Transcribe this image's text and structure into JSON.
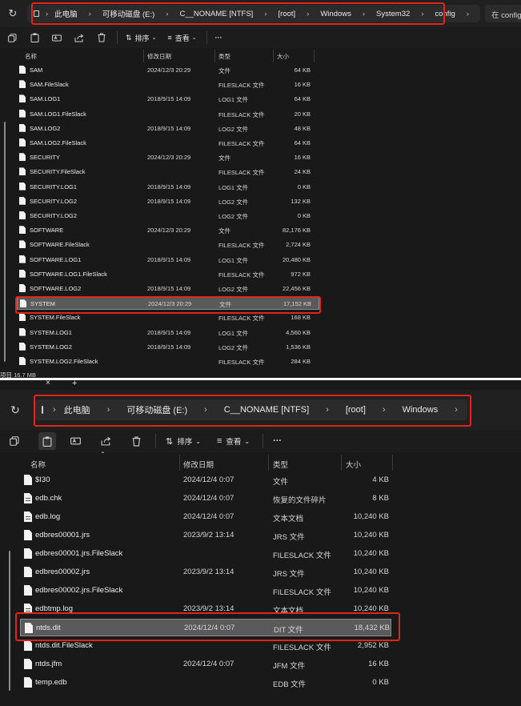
{
  "top": {
    "breadcrumb": [
      "此电脑",
      "可移动磁盘 (E:)",
      "C__NONAME [NTFS]",
      "[root]",
      "Windows",
      "System32",
      "config"
    ],
    "search_placeholder": "在 config",
    "toolbar": {
      "sort_label": "排序",
      "view_label": "查看",
      "more_label": "···"
    },
    "columns": {
      "name": "名称",
      "date": "修改日期",
      "type": "类型",
      "size": "大小"
    },
    "files": [
      {
        "name": "SAM",
        "date": "2024/12/3 20:29",
        "type": "文件",
        "size": "64 KB"
      },
      {
        "name": "SAM.FileSlack",
        "date": "",
        "type": "FILESLACK 文件",
        "size": "16 KB"
      },
      {
        "name": "SAM.LOG1",
        "date": "2018/9/15 14:09",
        "type": "LOG1 文件",
        "size": "64 KB"
      },
      {
        "name": "SAM.LOG1.FileSlack",
        "date": "",
        "type": "FILESLACK 文件",
        "size": "20 KB"
      },
      {
        "name": "SAM.LOG2",
        "date": "2018/9/15 14:09",
        "type": "LOG2 文件",
        "size": "48 KB"
      },
      {
        "name": "SAM.LOG2.FileSlack",
        "date": "",
        "type": "FILESLACK 文件",
        "size": "64 KB"
      },
      {
        "name": "SECURITY",
        "date": "2024/12/3 20:29",
        "type": "文件",
        "size": "16 KB"
      },
      {
        "name": "SECURITY.FileSlack",
        "date": "",
        "type": "FILESLACK 文件",
        "size": "24 KB"
      },
      {
        "name": "SECURITY.LOG1",
        "date": "2018/9/15 14:09",
        "type": "LOG1 文件",
        "size": "0 KB"
      },
      {
        "name": "SECURITY.LOG2",
        "date": "2018/9/15 14:09",
        "type": "LOG2 文件",
        "size": "132 KB"
      },
      {
        "name": "SECURITY.LOG2",
        "date": "",
        "type": "LOG2 文件",
        "size": "0 KB"
      },
      {
        "name": "SOFTWARE",
        "date": "2024/12/3 20:29",
        "type": "文件",
        "size": "82,176 KB"
      },
      {
        "name": "SOFTWARE.FileSlack",
        "date": "",
        "type": "FILESLACK 文件",
        "size": "2,724 KB"
      },
      {
        "name": "SOFTWARE.LOG1",
        "date": "2018/9/15 14:09",
        "type": "LOG1 文件",
        "size": "20,480 KB"
      },
      {
        "name": "SOFTWARE.LOG1.FileSlack",
        "date": "",
        "type": "FILESLACK 文件",
        "size": "972 KB"
      },
      {
        "name": "SOFTWARE.LOG2",
        "date": "2018/9/15 14:09",
        "type": "LOG2 文件",
        "size": "22,456 KB"
      },
      {
        "name": "SYSTEM",
        "date": "2024/12/3 20:29",
        "type": "文件",
        "size": "17,152 KB",
        "selected": true
      },
      {
        "name": "SYSTEM.FileSlack",
        "date": "",
        "type": "FILESLACK 文件",
        "size": "168 KB"
      },
      {
        "name": "SYSTEM.LOG1",
        "date": "2018/9/15 14:09",
        "type": "LOG1 文件",
        "size": "4,560 KB"
      },
      {
        "name": "SYSTEM.LOG2",
        "date": "2018/9/15 14:09",
        "type": "LOG2 文件",
        "size": "1,536 KB"
      },
      {
        "name": "SYSTEM.LOG2.FileSlack",
        "date": "",
        "type": "FILESLACK 文件",
        "size": "284 KB"
      }
    ],
    "status": "项目  16.7 MB"
  },
  "bottom": {
    "tab_close": "×",
    "tab_new": "+",
    "breadcrumb": [
      "此电脑",
      "可移动磁盘 (E:)",
      "C__NONAME [NTFS]",
      "[root]",
      "Windows",
      "NTDS"
    ],
    "toolbar": {
      "sort_label": "排序",
      "view_label": "查看",
      "more_label": "···"
    },
    "columns": {
      "name": "名称",
      "date": "修改日期",
      "type": "类型",
      "size": "大小"
    },
    "files": [
      {
        "name": "$I30",
        "date": "2024/12/4 0:07",
        "type": "文件",
        "size": "4 KB",
        "icon": "file"
      },
      {
        "name": "edb.chk",
        "date": "2024/12/4 0:07",
        "type": "恢复的文件碎片",
        "size": "8 KB",
        "icon": "doc"
      },
      {
        "name": "edb.log",
        "date": "2024/12/4 0:07",
        "type": "文本文档",
        "size": "10,240 KB",
        "icon": "doc"
      },
      {
        "name": "edbres00001.jrs",
        "date": "2023/9/2 13:14",
        "type": "JRS 文件",
        "size": "10,240 KB",
        "icon": "file"
      },
      {
        "name": "edbres00001.jrs.FileSlack",
        "date": "",
        "type": "FILESLACK 文件",
        "size": "10,240 KB",
        "icon": "file"
      },
      {
        "name": "edbres00002.jrs",
        "date": "2023/9/2 13:14",
        "type": "JRS 文件",
        "size": "10,240 KB",
        "icon": "file"
      },
      {
        "name": "edbres00002.jrs.FileSlack",
        "date": "",
        "type": "FILESLACK 文件",
        "size": "10,240 KB",
        "icon": "file"
      },
      {
        "name": "edbtmp.log",
        "date": "2023/9/2 13:14",
        "type": "文本文档",
        "size": "10,240 KB",
        "icon": "doc"
      },
      {
        "name": "ntds.dit",
        "date": "2024/12/4 0:07",
        "type": "DIT 文件",
        "size": "18,432 KB",
        "icon": "file",
        "selected": true
      },
      {
        "name": "ntds.dit.FileSlack",
        "date": "",
        "type": "FILESLACK 文件",
        "size": "2,952 KB",
        "icon": "file"
      },
      {
        "name": "ntds.jfm",
        "date": "2024/12/4 0:07",
        "type": "JFM 文件",
        "size": "16 KB",
        "icon": "file"
      },
      {
        "name": "temp.edb",
        "date": "",
        "type": "EDB 文件",
        "size": "0 KB",
        "icon": "file"
      }
    ]
  }
}
